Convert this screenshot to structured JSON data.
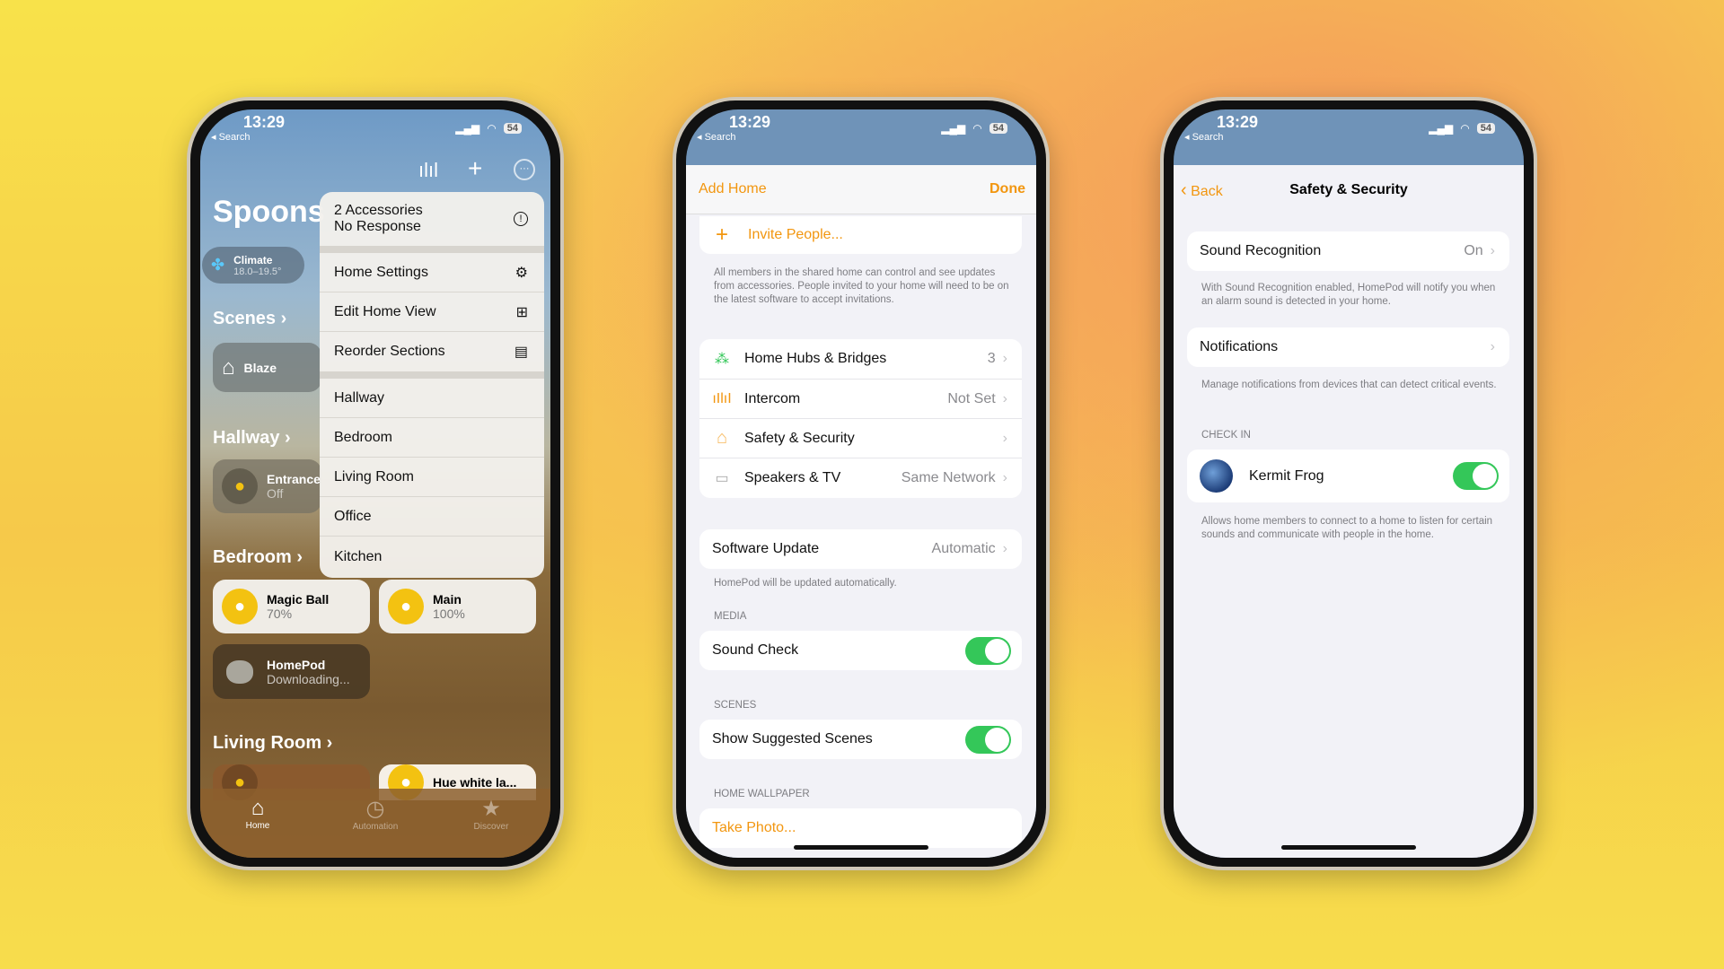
{
  "status_bar": {
    "time": "13:29",
    "back_label": "◂ Search",
    "battery": "54"
  },
  "colors": {
    "accent": "#f2960f",
    "toggle_on": "#34c759",
    "bulb": "#f3c211"
  },
  "phone1": {
    "home_name": "Spoons",
    "toolbar_icons": [
      "waveform-icon",
      "plus-icon",
      "more-icon"
    ],
    "climate": {
      "label": "Climate",
      "value": "18.0–19.5°"
    },
    "sections": {
      "scenes": "Scenes",
      "hallway": "Hallway",
      "bedroom": "Bedroom",
      "living_room": "Living Room"
    },
    "scene_tile": "Blaze",
    "entrance": {
      "name": "Entrance",
      "status": "Off"
    },
    "magic_ball": {
      "name": "Magic Ball",
      "status": "70%"
    },
    "main": {
      "name": "Main",
      "status": "100%"
    },
    "homepod": {
      "name": "HomePod",
      "status": "Downloading..."
    },
    "hue": {
      "name": "Hue white la..."
    },
    "menu": {
      "alert_line1": "2 Accessories",
      "alert_line2": "No Response",
      "actions": [
        "Home Settings",
        "Edit Home View",
        "Reorder Sections"
      ],
      "rooms": [
        "Hallway",
        "Bedroom",
        "Living Room",
        "Office",
        "Kitchen"
      ]
    },
    "tabs": [
      "Home",
      "Automation",
      "Discover"
    ]
  },
  "phone2": {
    "nav_left": "Add Home",
    "nav_right": "Done",
    "invite": "Invite People...",
    "invite_footer": "All members in the shared home can control and see updates from accessories. People invited to your home will need to be on the latest software to accept invitations.",
    "rows": [
      {
        "label": "Home Hubs & Bridges",
        "value": "3"
      },
      {
        "label": "Intercom",
        "value": "Not Set"
      },
      {
        "label": "Safety & Security",
        "value": ""
      },
      {
        "label": "Speakers & TV",
        "value": "Same Network"
      }
    ],
    "software_update": {
      "label": "Software Update",
      "value": "Automatic",
      "footer": "HomePod will be updated automatically."
    },
    "media_header": "MEDIA",
    "sound_check": "Sound Check",
    "sound_check_on": true,
    "scenes_header": "SCENES",
    "suggested_scenes": "Show Suggested Scenes",
    "suggested_on": true,
    "wallpaper_header": "HOME WALLPAPER",
    "take_photo": "Take Photo..."
  },
  "phone3": {
    "back": "Back",
    "title": "Safety & Security",
    "sound_recognition": {
      "label": "Sound Recognition",
      "value": "On",
      "footer": "With Sound Recognition enabled, HomePod will notify you when an alarm sound is detected in your home."
    },
    "notifications": {
      "label": "Notifications",
      "footer": "Manage notifications from devices that can detect critical events."
    },
    "check_in_header": "CHECK IN",
    "member": {
      "name": "Kermit  Frog",
      "enabled": true
    },
    "check_in_footer": "Allows home members to connect to a home to listen for certain sounds and communicate with people in the home."
  }
}
